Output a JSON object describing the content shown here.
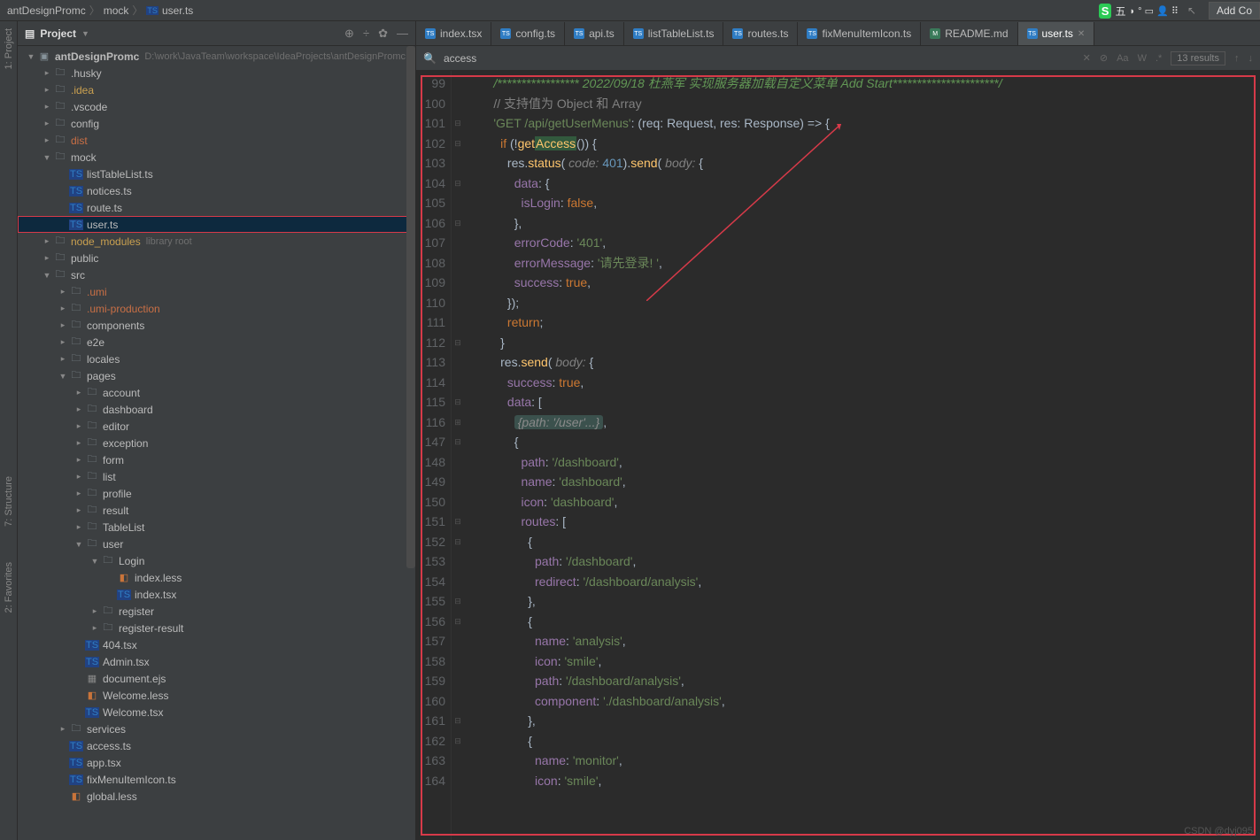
{
  "breadcrumb": {
    "project": "antDesignPromc",
    "folder": "mock",
    "file": "user.ts",
    "fileIcon": "TS"
  },
  "topRight": {
    "imeBadge": "S",
    "imeText": "五",
    "addBtn": "Add Co"
  },
  "leftGutter": {
    "project": "1: Project",
    "structure": "7: Structure",
    "favorites": "2: Favorites"
  },
  "projectPanel": {
    "title": "Project"
  },
  "tree": {
    "root": {
      "name": "antDesignPromc",
      "path": "D:\\work\\JavaTeam\\workspace\\IdeaProjects\\antDesignPromc"
    },
    "items": [
      {
        "d": 1,
        "e": ">",
        "t": "dir",
        "n": ".husky"
      },
      {
        "d": 1,
        "e": ">",
        "t": "dir",
        "n": ".idea",
        "c": "y"
      },
      {
        "d": 1,
        "e": ">",
        "t": "dir",
        "n": ".vscode"
      },
      {
        "d": 1,
        "e": ">",
        "t": "dir",
        "n": "config"
      },
      {
        "d": 1,
        "e": ">",
        "t": "dir",
        "n": "dist",
        "c": "o"
      },
      {
        "d": 1,
        "e": "v",
        "t": "dir",
        "n": "mock"
      },
      {
        "d": 2,
        "e": "",
        "t": "ts",
        "n": "listTableList.ts"
      },
      {
        "d": 2,
        "e": "",
        "t": "ts",
        "n": "notices.ts"
      },
      {
        "d": 2,
        "e": "",
        "t": "ts",
        "n": "route.ts"
      },
      {
        "d": 2,
        "e": "",
        "t": "ts",
        "n": "user.ts",
        "sel": true
      },
      {
        "d": 1,
        "e": ">",
        "t": "dir",
        "n": "node_modules",
        "c": "y",
        "suf": "library root"
      },
      {
        "d": 1,
        "e": ">",
        "t": "dir",
        "n": "public"
      },
      {
        "d": 1,
        "e": "v",
        "t": "dir",
        "n": "src"
      },
      {
        "d": 2,
        "e": ">",
        "t": "dir",
        "n": ".umi",
        "c": "o"
      },
      {
        "d": 2,
        "e": ">",
        "t": "dir",
        "n": ".umi-production",
        "c": "o"
      },
      {
        "d": 2,
        "e": ">",
        "t": "dir",
        "n": "components"
      },
      {
        "d": 2,
        "e": ">",
        "t": "dir",
        "n": "e2e"
      },
      {
        "d": 2,
        "e": ">",
        "t": "dir",
        "n": "locales"
      },
      {
        "d": 2,
        "e": "v",
        "t": "dir",
        "n": "pages"
      },
      {
        "d": 3,
        "e": ">",
        "t": "dir",
        "n": "account"
      },
      {
        "d": 3,
        "e": ">",
        "t": "dir",
        "n": "dashboard"
      },
      {
        "d": 3,
        "e": ">",
        "t": "dir",
        "n": "editor"
      },
      {
        "d": 3,
        "e": ">",
        "t": "dir",
        "n": "exception"
      },
      {
        "d": 3,
        "e": ">",
        "t": "dir",
        "n": "form"
      },
      {
        "d": 3,
        "e": ">",
        "t": "dir",
        "n": "list"
      },
      {
        "d": 3,
        "e": ">",
        "t": "dir",
        "n": "profile"
      },
      {
        "d": 3,
        "e": ">",
        "t": "dir",
        "n": "result"
      },
      {
        "d": 3,
        "e": ">",
        "t": "dir",
        "n": "TableList"
      },
      {
        "d": 3,
        "e": "v",
        "t": "dir",
        "n": "user"
      },
      {
        "d": 4,
        "e": "v",
        "t": "dir",
        "n": "Login"
      },
      {
        "d": 5,
        "e": "",
        "t": "less",
        "n": "index.less"
      },
      {
        "d": 5,
        "e": "",
        "t": "ts",
        "n": "index.tsx"
      },
      {
        "d": 4,
        "e": ">",
        "t": "dir",
        "n": "register"
      },
      {
        "d": 4,
        "e": ">",
        "t": "dir",
        "n": "register-result"
      },
      {
        "d": 3,
        "e": "",
        "t": "ts",
        "n": "404.tsx"
      },
      {
        "d": 3,
        "e": "",
        "t": "ts",
        "n": "Admin.tsx"
      },
      {
        "d": 3,
        "e": "",
        "t": "ejs",
        "n": "document.ejs"
      },
      {
        "d": 3,
        "e": "",
        "t": "less",
        "n": "Welcome.less"
      },
      {
        "d": 3,
        "e": "",
        "t": "ts",
        "n": "Welcome.tsx"
      },
      {
        "d": 2,
        "e": ">",
        "t": "dir",
        "n": "services"
      },
      {
        "d": 2,
        "e": "",
        "t": "ts",
        "n": "access.ts"
      },
      {
        "d": 2,
        "e": "",
        "t": "ts",
        "n": "app.tsx"
      },
      {
        "d": 2,
        "e": "",
        "t": "ts",
        "n": "fixMenuItemIcon.ts"
      },
      {
        "d": 2,
        "e": "",
        "t": "less",
        "n": "global.less"
      }
    ]
  },
  "tabs": [
    {
      "n": "index.tsx",
      "i": "ts"
    },
    {
      "n": "config.ts",
      "i": "ts"
    },
    {
      "n": "api.ts",
      "i": "ts"
    },
    {
      "n": "listTableList.ts",
      "i": "ts"
    },
    {
      "n": "routes.ts",
      "i": "ts"
    },
    {
      "n": "fixMenuItemIcon.ts",
      "i": "ts"
    },
    {
      "n": "README.md",
      "i": "md"
    },
    {
      "n": "user.ts",
      "i": "ts",
      "active": true,
      "close": true
    }
  ],
  "search": {
    "query": "access",
    "results": "13 results",
    "icons": [
      "✕",
      "⊘",
      "Aa",
      "W",
      ".*"
    ]
  },
  "code": {
    "startLine": 99,
    "lines": [
      {
        "n": 99,
        "f": "",
        "html": "<span class='cm2'>/***************** </span><span class='date'>2022/09/18</span><span class='cm2'> 杜燕军 实现服务器加载自定义菜单 Add Start**********************/</span>"
      },
      {
        "n": 100,
        "f": "",
        "html": "<span class='cm'>// 支持值为 Object 和 Array</span>"
      },
      {
        "n": 101,
        "f": "⊟",
        "html": "<span class='str'>'GET /api/getUserMenus'</span><span class='pn'>: (</span><span class='par'>req</span><span class='pn'>: Request, </span><span class='par'>res</span><span class='pn'>: Response) =&gt; {</span>"
      },
      {
        "n": 102,
        "f": "⊟",
        "html": "  <span class='kw'>if </span><span class='pn'>(!</span><span class='fn'>get<span class='hl'>Access</span></span><span class='pn'>()) {</span>"
      },
      {
        "n": 103,
        "f": "",
        "html": "    <span class='par'>res</span><span class='pn'>.</span><span class='fn'>status</span><span class='pn'>(</span> <span class='gy'>code:</span> <span class='num'>401</span><span class='pn'>).</span><span class='fn'>send</span><span class='pn'>(</span> <span class='gy'>body:</span> <span class='pn'>{</span>"
      },
      {
        "n": 104,
        "f": "⊟",
        "html": "      <span class='prop'>data</span><span class='pn'>: {</span>"
      },
      {
        "n": 105,
        "f": "",
        "html": "        <span class='prop'>isLogin</span><span class='pn'>: </span><span class='kw'>false</span><span class='pn'>,</span>"
      },
      {
        "n": 106,
        "f": "⊟",
        "html": "      <span class='pn'>},</span>"
      },
      {
        "n": 107,
        "f": "",
        "html": "      <span class='prop'>errorCode</span><span class='pn'>: </span><span class='str'>'401'</span><span class='pn'>,</span>"
      },
      {
        "n": 108,
        "f": "",
        "html": "      <span class='prop'>errorMessage</span><span class='pn'>: </span><span class='str'>'请先登录! '</span><span class='pn'>,</span>"
      },
      {
        "n": 109,
        "f": "",
        "html": "      <span class='prop'>success</span><span class='pn'>: </span><span class='kw'>true</span><span class='pn'>,</span>"
      },
      {
        "n": 110,
        "f": "",
        "html": "    <span class='pn'>});</span>"
      },
      {
        "n": 111,
        "f": "",
        "html": "    <span class='kw'>return</span><span class='pn'>;</span>"
      },
      {
        "n": 112,
        "f": "⊟",
        "html": "  <span class='pn'>}</span>"
      },
      {
        "n": 113,
        "f": "",
        "html": "  <span class='par'>res</span><span class='pn'>.</span><span class='fn'>send</span><span class='pn'>(</span> <span class='gy'>body:</span> <span class='pn'>{</span>"
      },
      {
        "n": 114,
        "f": "",
        "html": "    <span class='prop'>success</span><span class='pn'>: </span><span class='kw'>true</span><span class='pn'>,</span>"
      },
      {
        "n": 115,
        "f": "⊟",
        "html": "    <span class='prop'>data</span><span class='pn'>: [</span>"
      },
      {
        "n": 116,
        "f": "⊞",
        "html": "      <span class='fold-txt'>{path: '/user'...}</span><span class='pn'>,</span>"
      },
      {
        "n": 147,
        "f": "⊟",
        "html": "      <span class='pn'>{</span>"
      },
      {
        "n": 148,
        "f": "",
        "html": "        <span class='prop'>path</span><span class='pn'>: </span><span class='str'>'/dashboard'</span><span class='pn'>,</span>"
      },
      {
        "n": 149,
        "f": "",
        "html": "        <span class='prop'>name</span><span class='pn'>: </span><span class='str'>'dashboard'</span><span class='pn'>,</span>"
      },
      {
        "n": 150,
        "f": "",
        "html": "        <span class='prop'>icon</span><span class='pn'>: </span><span class='str'>'dashboard'</span><span class='pn'>,</span>"
      },
      {
        "n": 151,
        "f": "⊟",
        "html": "        <span class='prop'>routes</span><span class='pn'>: [</span>"
      },
      {
        "n": 152,
        "f": "⊟",
        "html": "          <span class='pn'>{</span>"
      },
      {
        "n": 153,
        "f": "",
        "html": "            <span class='prop'>path</span><span class='pn'>: </span><span class='str'>'/dashboard'</span><span class='pn'>,</span>"
      },
      {
        "n": 154,
        "f": "",
        "html": "            <span class='prop'>redirect</span><span class='pn'>: </span><span class='str'>'/dashboard/analysis'</span><span class='pn'>,</span>"
      },
      {
        "n": 155,
        "f": "⊟",
        "html": "          <span class='pn'>},</span>"
      },
      {
        "n": 156,
        "f": "⊟",
        "html": "          <span class='pn'>{</span>"
      },
      {
        "n": 157,
        "f": "",
        "html": "            <span class='prop'>name</span><span class='pn'>: </span><span class='str'>'analysis'</span><span class='pn'>,</span>"
      },
      {
        "n": 158,
        "f": "",
        "html": "            <span class='prop'>icon</span><span class='pn'>: </span><span class='str'>'smile'</span><span class='pn'>,</span>"
      },
      {
        "n": 159,
        "f": "",
        "html": "            <span class='prop'>path</span><span class='pn'>: </span><span class='str'>'/dashboard/analysis'</span><span class='pn'>,</span>"
      },
      {
        "n": 160,
        "f": "",
        "html": "            <span class='prop'>component</span><span class='pn'>: </span><span class='str'>'./dashboard/analysis'</span><span class='pn'>,</span>"
      },
      {
        "n": 161,
        "f": "⊟",
        "html": "          <span class='pn'>},</span>"
      },
      {
        "n": 162,
        "f": "⊟",
        "html": "          <span class='pn'>{</span>"
      },
      {
        "n": 163,
        "f": "",
        "html": "            <span class='prop'>name</span><span class='pn'>: </span><span class='str'>'monitor'</span><span class='pn'>,</span>"
      },
      {
        "n": 164,
        "f": "",
        "html": "            <span class='prop'>icon</span><span class='pn'>: </span><span class='str'>'smile'</span><span class='pn'>,</span>"
      }
    ]
  },
  "watermark": "CSDN @dyj095"
}
